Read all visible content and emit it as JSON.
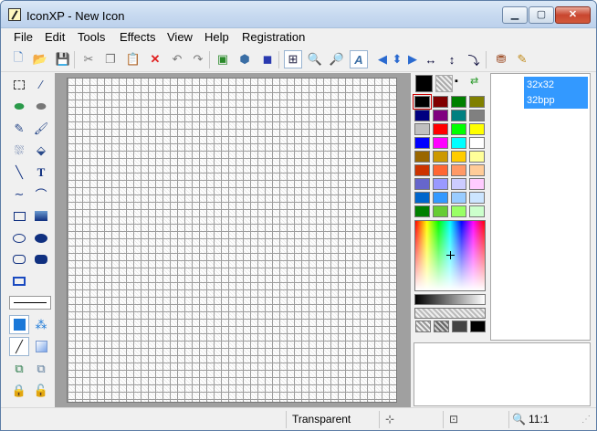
{
  "window": {
    "title": "IconXP - New Icon",
    "icon": "pen-app-icon",
    "controls": [
      "minimize-icon",
      "maximize-icon",
      "close-icon"
    ]
  },
  "menu": [
    "File",
    "Edit",
    "Tools",
    "Effects",
    "View",
    "Help",
    "Registration"
  ],
  "toolbar": {
    "buttons": [
      "new-icon",
      "open-icon",
      "save-icon",
      "cut-icon",
      "copy-icon",
      "paste-icon",
      "delete-icon",
      "undo-icon",
      "redo-icon",
      "select-all-icon",
      "3d-box-icon",
      "frame-icon",
      "grid-icon",
      "zoom-in-icon",
      "zoom-out-icon",
      "antialias-icon",
      "move-left-icon",
      "move-up-down-icon",
      "move-right-icon",
      "flip-horizontal-icon",
      "flip-vertical-icon",
      "rotate-icon",
      "preview-icon",
      "register-icon"
    ]
  },
  "tools": [
    "rect-select",
    "dropper",
    "eraser",
    "fill-eraser",
    "pencil",
    "brush",
    "spray",
    "fill-bucket",
    "line",
    "text",
    "curve",
    "arc",
    "rectangle",
    "filled-rectangle",
    "ellipse",
    "filled-ellipse",
    "rounded-rect",
    "filled-rounded-rect",
    "rect-outline",
    "line-width",
    "color-mode-solid",
    "color-mode-pattern",
    "line-style",
    "shading",
    "copy-layer",
    "move-layer",
    "lock",
    "unlock"
  ],
  "palette": {
    "colors": [
      "#000000",
      "#800000",
      "#008000",
      "#808000",
      "#000080",
      "#800080",
      "#008080",
      "#808080",
      "#c0c0c0",
      "#ff0000",
      "#00ff00",
      "#ffff00",
      "#0000ff",
      "#ff00ff",
      "#00ffff",
      "#ffffff",
      "#996600",
      "#cc9900",
      "#ffcc00",
      "#ffff99",
      "#cc3300",
      "#ff6633",
      "#ff9966",
      "#ffcc99",
      "#6666cc",
      "#9999ff",
      "#ccccff",
      "#ffccff",
      "#0066cc",
      "#3399ff",
      "#99ccff",
      "#cce5ff",
      "#008000",
      "#66cc33",
      "#99ff66",
      "#ccffcc"
    ],
    "fg_color": "#000000",
    "bg_color": "transparent"
  },
  "formats": [
    "32x32",
    "32bpp"
  ],
  "status": {
    "mode": "Transparent",
    "zoom": "11:1"
  }
}
